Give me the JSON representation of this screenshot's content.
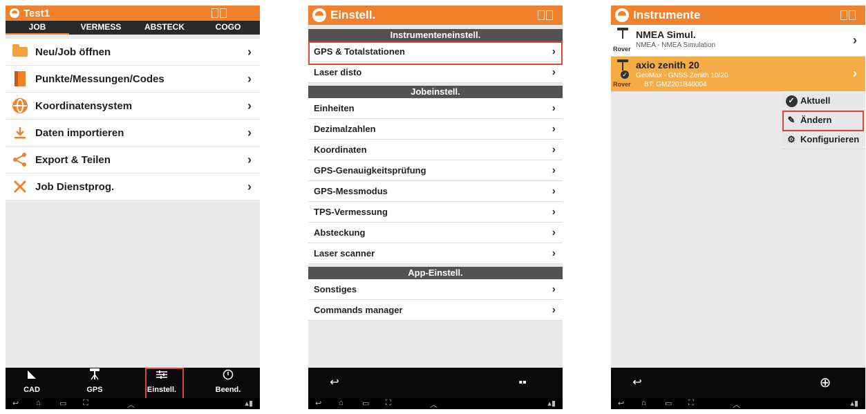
{
  "phone1": {
    "title": "Test1",
    "tabs": [
      "JOB",
      "VERMESS",
      "ABSTECK",
      "COGO"
    ],
    "menu": [
      {
        "label": "Neu/Job öffnen",
        "icon": "folder-icon"
      },
      {
        "label": "Punkte/Messungen/Codes",
        "icon": "book-icon"
      },
      {
        "label": "Koordinatensystem",
        "icon": "globe-icon"
      },
      {
        "label": "Daten importieren",
        "icon": "download-icon"
      },
      {
        "label": "Export & Teilen",
        "icon": "share-icon"
      },
      {
        "label": "Job Dienstprog.",
        "icon": "tools-icon"
      }
    ],
    "bottom": [
      {
        "label": "CAD",
        "icon": "cad-icon"
      },
      {
        "label": "GPS",
        "icon": "gps-icon"
      },
      {
        "label": "Einstell.",
        "icon": "sliders-icon"
      },
      {
        "label": "Beend.",
        "icon": "power-icon"
      }
    ]
  },
  "phone2": {
    "title": "Einstell.",
    "sections": [
      {
        "header": "Instrumenteneinstell.",
        "rows": [
          "GPS & Totalstationen",
          "Laser disto"
        ]
      },
      {
        "header": "Jobeinstell.",
        "rows": [
          "Einheiten",
          "Dezimalzahlen",
          "Koordinaten",
          "GPS-Genauigkeitsprüfung",
          "GPS-Messmodus",
          "TPS-Vermessung",
          "Absteckung",
          "Laser scanner"
        ]
      },
      {
        "header": "App-Einstell.",
        "rows": [
          "Sonstiges",
          "Commands manager"
        ]
      }
    ]
  },
  "phone3": {
    "title": "Instrumente",
    "instruments": [
      {
        "name": "NMEA Simul.",
        "sub1": "NMEA - NMEA Simulation",
        "sub2": "",
        "role": "Rover"
      },
      {
        "name": "axio zenith 20",
        "sub1": "GeoMax - GNSS Zenith 10/20",
        "sub2": "BT: GMZ201B40004",
        "role": "Rover"
      }
    ],
    "popup": [
      "Aktuell",
      "Ändern",
      "Konfigurieren"
    ]
  },
  "colors": {
    "accent": "#f0822d",
    "selected": "#f4ad46",
    "section": "#525252",
    "highlight": "#d9492f"
  }
}
